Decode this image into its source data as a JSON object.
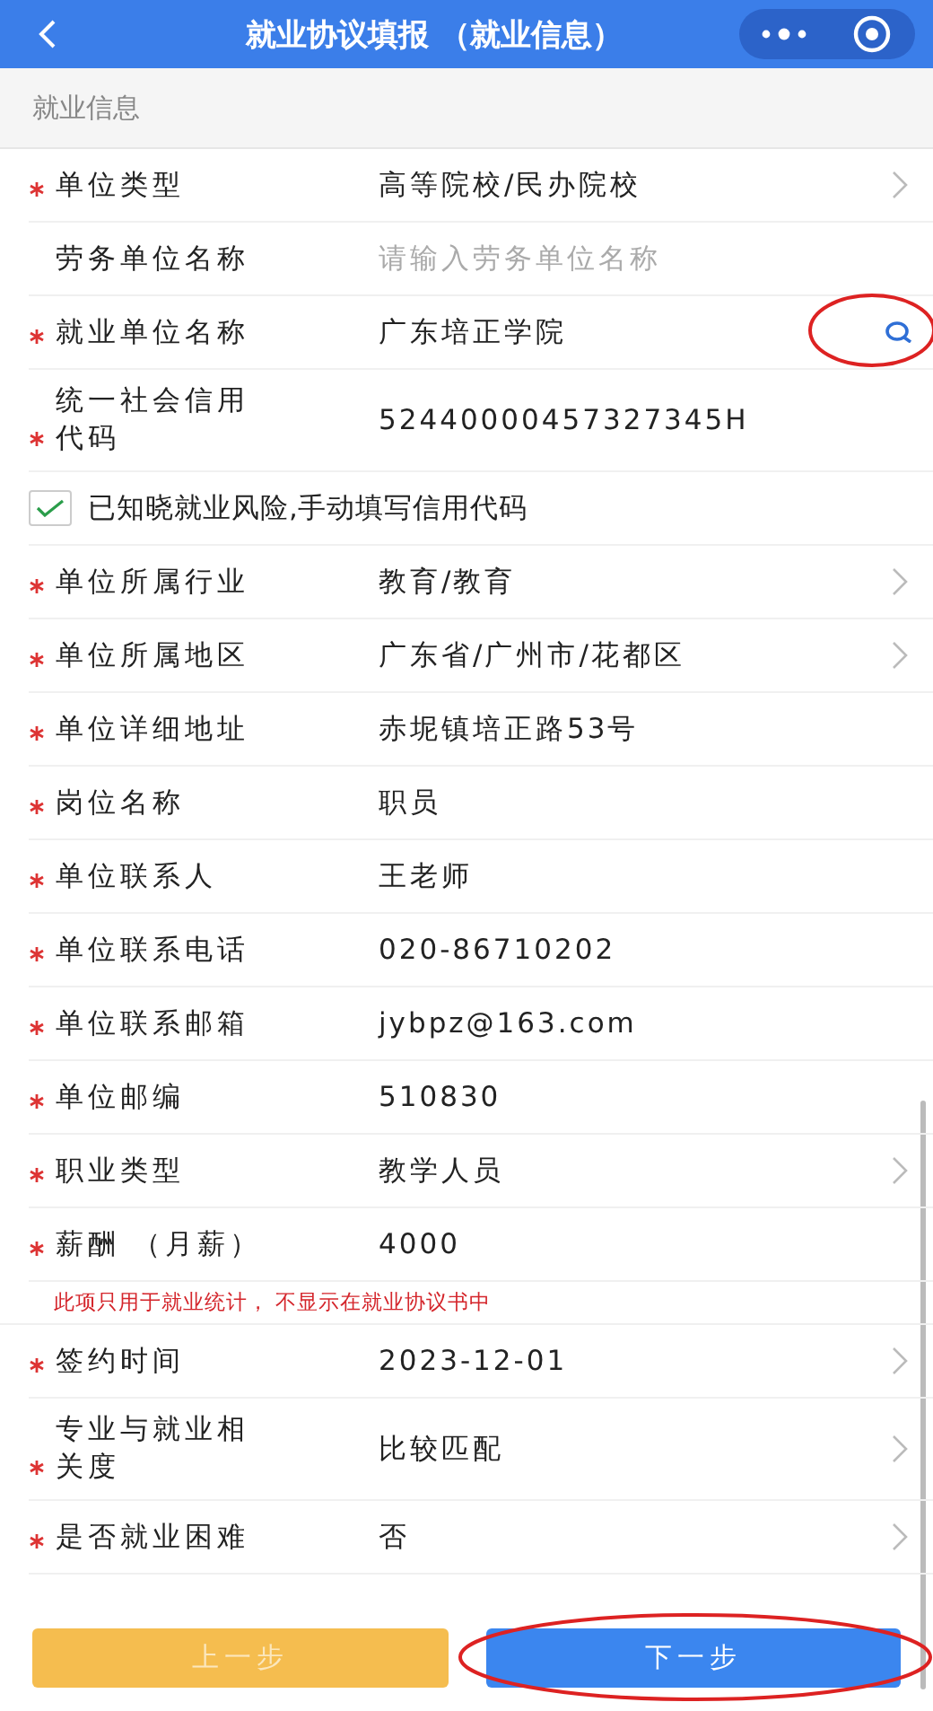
{
  "header": {
    "title": "就业协议填报 （就业信息）"
  },
  "section": {
    "title": "就业信息"
  },
  "rows": [
    {
      "kind": "field",
      "required": true,
      "label": "单位类型",
      "value": "高等院校/民办院校",
      "chevron": true
    },
    {
      "kind": "field",
      "required": false,
      "label": "劳务单位名称",
      "placeholder": "请输入劳务单位名称",
      "chevron": false
    },
    {
      "kind": "field",
      "required": true,
      "label": "就业单位名称",
      "value": "广东培正学院",
      "chevron": false,
      "search": true,
      "circled": true
    },
    {
      "kind": "field",
      "required": true,
      "label": "统一社会信用代码",
      "value": "52440000457327345H",
      "chevron": false
    },
    {
      "kind": "checkbox",
      "checked": true,
      "label": "已知晓就业风险,手动填写信用代码"
    },
    {
      "kind": "field",
      "required": true,
      "label": "单位所属行业",
      "value": "教育/教育",
      "chevron": true
    },
    {
      "kind": "field",
      "required": true,
      "label": "单位所属地区",
      "value": "广东省/广州市/花都区",
      "chevron": true
    },
    {
      "kind": "field",
      "required": true,
      "label": "单位详细地址",
      "value": "赤坭镇培正路53号",
      "chevron": false
    },
    {
      "kind": "field",
      "required": true,
      "label": "岗位名称",
      "value": "职员",
      "chevron": false
    },
    {
      "kind": "field",
      "required": true,
      "label": "单位联系人",
      "value": "王老师",
      "chevron": false
    },
    {
      "kind": "field",
      "required": true,
      "label": "单位联系电话",
      "value": "020-86710202",
      "chevron": false
    },
    {
      "kind": "field",
      "required": true,
      "label": "单位联系邮箱",
      "value": "jybpz@163.com",
      "chevron": false
    },
    {
      "kind": "field",
      "required": true,
      "label": "单位邮编",
      "value": "510830",
      "chevron": false
    },
    {
      "kind": "field",
      "required": true,
      "label": "职业类型",
      "value": "教学人员",
      "chevron": true
    },
    {
      "kind": "field",
      "required": true,
      "label": "薪酬 （月薪）",
      "value": "4000",
      "chevron": false
    },
    {
      "kind": "note",
      "text": "此项只用于就业统计， 不显示在就业协议书中"
    },
    {
      "kind": "field",
      "required": true,
      "label": "签约时间",
      "value": "2023-12-01",
      "chevron": true
    },
    {
      "kind": "field",
      "required": true,
      "label": "专业与就业相关度",
      "value": "比较匹配",
      "chevron": true
    },
    {
      "kind": "field",
      "required": true,
      "label": "是否就业困难",
      "value": "否",
      "chevron": true
    }
  ],
  "buttons": [
    {
      "label": "上一步",
      "kind": "secondary",
      "circled": false
    },
    {
      "label": "下一步",
      "kind": "primary",
      "circled": true
    }
  ]
}
